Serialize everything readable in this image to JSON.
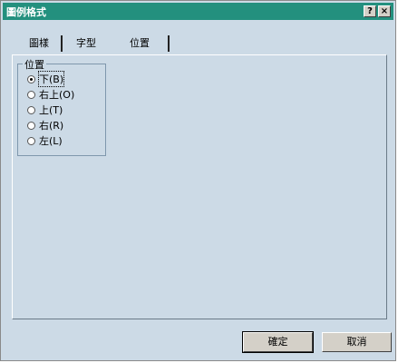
{
  "window": {
    "title": "圖例格式",
    "help_label": "?",
    "close_label": "×"
  },
  "tabs": [
    {
      "label": "圖樣",
      "selected": false
    },
    {
      "label": "字型",
      "selected": false
    },
    {
      "label": "位置",
      "selected": true
    }
  ],
  "placement": {
    "legend": "位置",
    "options": [
      {
        "label": "下(B)",
        "checked": true
      },
      {
        "label": "右上(O)",
        "checked": false
      },
      {
        "label": "上(T)",
        "checked": false
      },
      {
        "label": "右(R)",
        "checked": false
      },
      {
        "label": "左(L)",
        "checked": false
      }
    ]
  },
  "buttons": {
    "ok": "確定",
    "cancel": "取消"
  }
}
